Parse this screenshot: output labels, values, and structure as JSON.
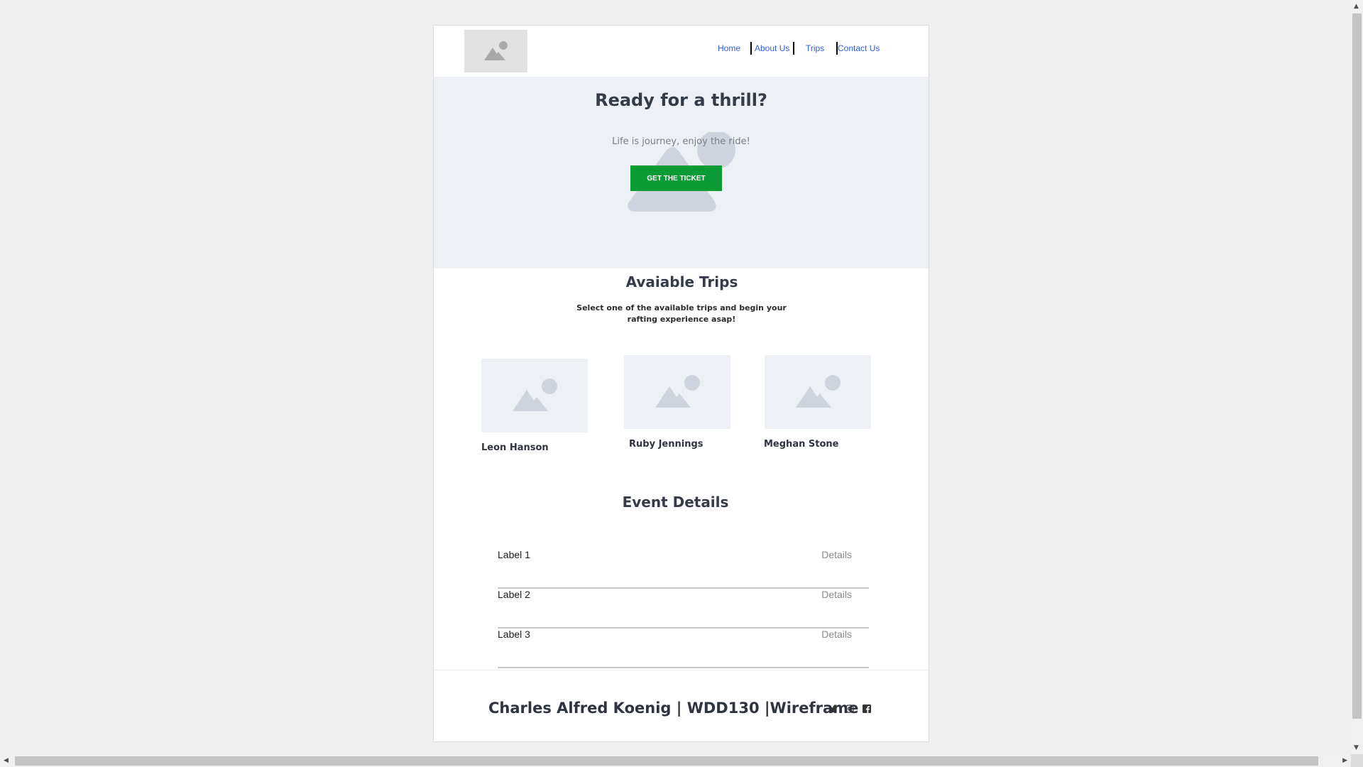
{
  "nav": {
    "items": [
      {
        "label": "Home"
      },
      {
        "label": "About Us"
      },
      {
        "label": "Trips"
      },
      {
        "label": "Contact Us"
      }
    ]
  },
  "hero": {
    "title": "Ready for a thrill?",
    "subtitle": "Life is journey, enjoy the ride!",
    "button_label": "GET THE TICKET"
  },
  "trips": {
    "title": "Avaiable Trips",
    "subtitle": "Select one of the available trips and begin your rafting experience asap!",
    "cards": [
      {
        "name": "Leon Hanson"
      },
      {
        "name": "Ruby Jennings"
      },
      {
        "name": "Meghan Stone"
      }
    ]
  },
  "events": {
    "title": "Event Details",
    "rows": [
      {
        "label": "Label 1",
        "details": "Details"
      },
      {
        "label": "Label 2",
        "details": "Details"
      },
      {
        "label": "Label 3",
        "details": "Details"
      }
    ]
  },
  "footer": {
    "text": "Charles Alfred Koenig | WDD130 |Wireframe",
    "social_icons": [
      "twitter-icon",
      "instagram-icon",
      "facebook-icon"
    ]
  },
  "colors": {
    "link": "#2f5ee6",
    "button": "#0b9b35",
    "hero_bg": "#edf0f4",
    "heading": "#343c4a"
  }
}
